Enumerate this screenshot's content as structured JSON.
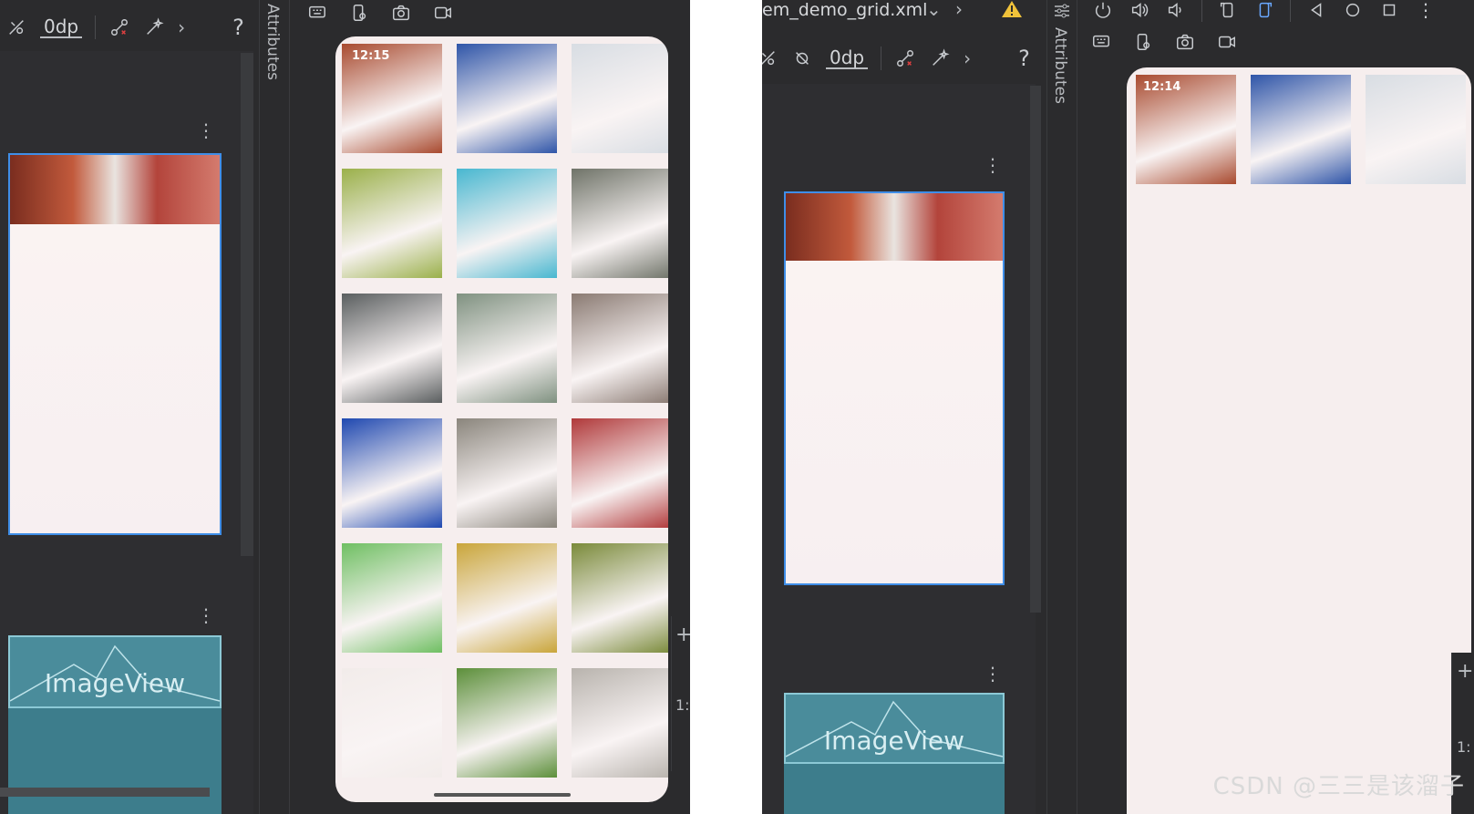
{
  "left": {
    "toolbar": {
      "dp_value": "0dp",
      "help": "?"
    },
    "attributes_label": "Attributes",
    "phone": {
      "status_time": "12:15",
      "rows": [
        [
          "#a84a2f",
          "#2f55a8",
          "#d8dde3"
        ],
        [
          "#9ab04a",
          "#48b7d0",
          "#6f7368"
        ],
        [
          "#5a5e5f",
          "#7f9180",
          "#8a7a72"
        ],
        [
          "#1f48b0",
          "#8a857c",
          "#b0393a"
        ],
        [
          "#6fbf62",
          "#c9a53a",
          "#7a8a3a"
        ],
        [
          "#f2ecea",
          "#5c8f3a",
          "#b8b3ad"
        ]
      ]
    },
    "imageview_label": "ImageView"
  },
  "right": {
    "file_title": "em_demo_grid.xml",
    "toolbar": {
      "dp_value": "0dp",
      "help": "?"
    },
    "attributes_label": "Attributes",
    "phone": {
      "status_time": "12:14",
      "rows": [
        [
          "#a84a2f",
          "#2f55a8",
          "#d8dde3"
        ]
      ]
    },
    "imageview_label": "ImageView",
    "ratio_label": "1:"
  },
  "watermark": "CSDN @三三是该溜子",
  "colors": {
    "selection": "#3f8ee8",
    "imageview": "#3d7d8c",
    "panel": "#2b2b2d"
  }
}
